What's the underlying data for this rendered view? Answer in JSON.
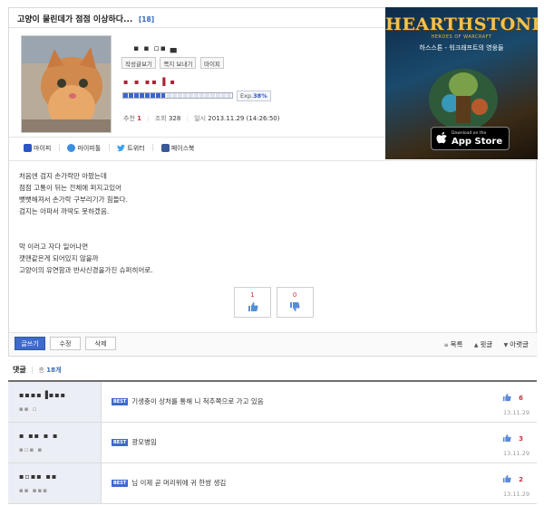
{
  "post": {
    "title": "고양이 물린데가 점점 이상하다...",
    "comment_count": "[18]",
    "author": {
      "nickname": "▪ ▪ ▫▪ ▄",
      "level": "▪  ▪ ▪▪  ▌▪",
      "buttons": [
        "작성글보기",
        "쪽지 보내기",
        "마이피"
      ],
      "exp_label": "Exp.",
      "exp_percent": "38%",
      "exp_fraction": 0.38
    },
    "stats": {
      "rec_label": "추천",
      "rec_value": "1",
      "views_label": "조회",
      "views_value": "328",
      "date_label": "일시",
      "date_value": "2013.11.29 (14:26:50)"
    },
    "share": [
      "마이피",
      "마이피툴",
      "트위터",
      "페이스북"
    ],
    "content": {
      "paragraph1": [
        "처음엔 검지 손가락만 아팠는데",
        "점점 고통이 뒤는 전체에 퍼지고있어",
        "뻣뻣해져서 손가락 구부리기가 힘들다.",
        "검지는 아파서 까딱도 못하겠음."
      ],
      "paragraph2": [
        "막 이러고 자다 일어나면",
        "잿맨같은게 되어있지 않을까",
        "고양이의 유연함과 반사신경을가진 슈퍼히어로."
      ]
    },
    "votes": {
      "up": "1",
      "down": "0"
    },
    "actions": [
      "글쓰기",
      "수정",
      "삭제"
    ],
    "nav_links": [
      "목록",
      "윗글",
      "아랫글"
    ]
  },
  "ad": {
    "logo": "HEARTHSTONE",
    "subtitle": "HEROES OF WARCRAFT",
    "tagline": "하스스톤 - 워크래프트의 영웅들",
    "store_small": "Download on the",
    "store_big": "App Store"
  },
  "comments": {
    "title": "댓글",
    "total_label": "총",
    "total": "18개",
    "items": [
      {
        "name": "▪▪▪▪▐▪▪▪",
        "sub": "▪▪  ▫",
        "badge": "BEST",
        "text": "기생충이 상처를 통해 니 척추쪽으로 가고 있음",
        "likes": "6",
        "date": "13.11.29"
      },
      {
        "name": "▪ ▪▪  ▪ ▪",
        "sub": "▪▫▪ ▪",
        "badge": "BEST",
        "text": "광모병임",
        "likes": "3",
        "date": "13.11.29"
      },
      {
        "name": "▪▫▪▪ ▪▪",
        "sub": "▪▪ ▪▪▪",
        "badge": "BEST",
        "text": "님 이제 곧 머리위에 귀 한쌍 생김",
        "likes": "2",
        "date": "13.11.29"
      }
    ]
  },
  "colors": {
    "accent": "#3e6bc8",
    "recommend_red": "#c8343d",
    "comment_author_bg": "#eceef6"
  }
}
